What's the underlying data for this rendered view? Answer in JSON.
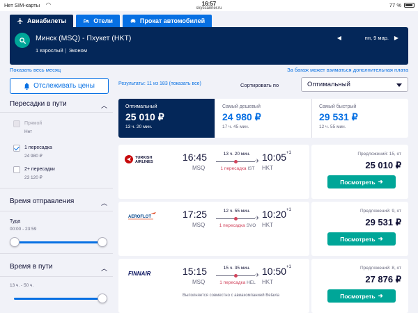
{
  "status_bar": {
    "carrier": "Нет SIM-карты",
    "time": "16:57",
    "url": "skyscanner.ru",
    "battery": "77 %"
  },
  "nav_tabs": [
    {
      "label": "Авиабилеты",
      "icon": "plane-icon",
      "active": true
    },
    {
      "label": "Отели",
      "icon": "bed-icon",
      "active": false
    },
    {
      "label": "Прокат автомобилей",
      "icon": "car-icon",
      "active": false
    }
  ],
  "search": {
    "route": "Минск (MSQ) - Пхукет (HKT)",
    "passengers": "1 взрослый",
    "cabin": "Эконом",
    "date": "пн, 9 мар."
  },
  "links": {
    "month": "Показать весь месяц",
    "baggage": "За багаж может взиматься дополнительная плата"
  },
  "sidebar": {
    "track_button": "Отслеживать цены",
    "transfers": {
      "title": "Пересадки в пути",
      "options": [
        {
          "label": "Прямой",
          "sub": "Нет",
          "checked": false,
          "disabled": true
        },
        {
          "label": "1 пересадка",
          "sub": "24 980 ₽",
          "checked": true,
          "disabled": false
        },
        {
          "label": "2+ пересадки",
          "sub": "23 120 ₽",
          "checked": false,
          "disabled": false
        }
      ]
    },
    "departure": {
      "title": "Время отправления",
      "label": "Туда",
      "range": "00:00 - 23:59"
    },
    "duration": {
      "title": "Время в пути",
      "range": "13 ч. - 50 ч."
    }
  },
  "results": {
    "count_text": "Результаты: 11 из 183 (показать все)",
    "sort_label": "Сортировать по",
    "sort_value": "Оптимальный"
  },
  "sort_tabs": [
    {
      "label": "Оптимальный",
      "price": "25 010 ₽",
      "duration": "13 ч. 20 мин.",
      "active": true
    },
    {
      "label": "Самый дешевый",
      "price": "24 980 ₽",
      "duration": "17 ч. 45 мин.",
      "active": false
    },
    {
      "label": "Самый быстрый",
      "price": "29 531 ₽",
      "duration": "12 ч. 55 мин.",
      "active": false
    }
  ],
  "flights": [
    {
      "airline": "TURKISH AIRLINES",
      "logo_lines": [
        "TURKISH",
        "AIRLINES"
      ],
      "dep_time": "16:45",
      "dep_code": "MSQ",
      "arr_time": "10:05",
      "arr_plus": "+1",
      "arr_code": "HKT",
      "duration": "13 ч. 20 мин.",
      "stops": "1 пересадка",
      "stop_airport": "IST",
      "operated": "",
      "offers": "Предложений: 15, от",
      "price": "25 010 ₽",
      "button": "Посмотреть",
      "logo_color": "#c70a0c"
    },
    {
      "airline": "AEROFLOT",
      "logo_lines": [
        "AEROFLOT"
      ],
      "dep_time": "17:25",
      "dep_code": "MSQ",
      "arr_time": "10:20",
      "arr_plus": "+1",
      "arr_code": "HKT",
      "duration": "12 ч. 55 мин.",
      "stops": "1 пересадка",
      "stop_airport": "SVO",
      "operated": "",
      "offers": "Предложений: 9, от",
      "price": "29 531 ₽",
      "button": "Посмотреть",
      "logo_color": "#02458a"
    },
    {
      "airline": "FINNAIR",
      "logo_lines": [
        "FINNAIR"
      ],
      "dep_time": "15:15",
      "dep_code": "MSQ",
      "arr_time": "10:50",
      "arr_plus": "+1",
      "arr_code": "HKT",
      "duration": "15 ч. 35 мин.",
      "stops": "1 пересадка",
      "stop_airport": "HEL",
      "operated": "Выполняется совместно с авиакомпанией Belavia",
      "offers": "Предложений: 8, от",
      "price": "27 876 ₽",
      "button": "Посмотреть",
      "logo_color": "#0b1560"
    }
  ],
  "colors": {
    "brand_blue": "#0770e3",
    "navy": "#042759",
    "teal": "#00a698",
    "stop_red": "#d1435b"
  }
}
